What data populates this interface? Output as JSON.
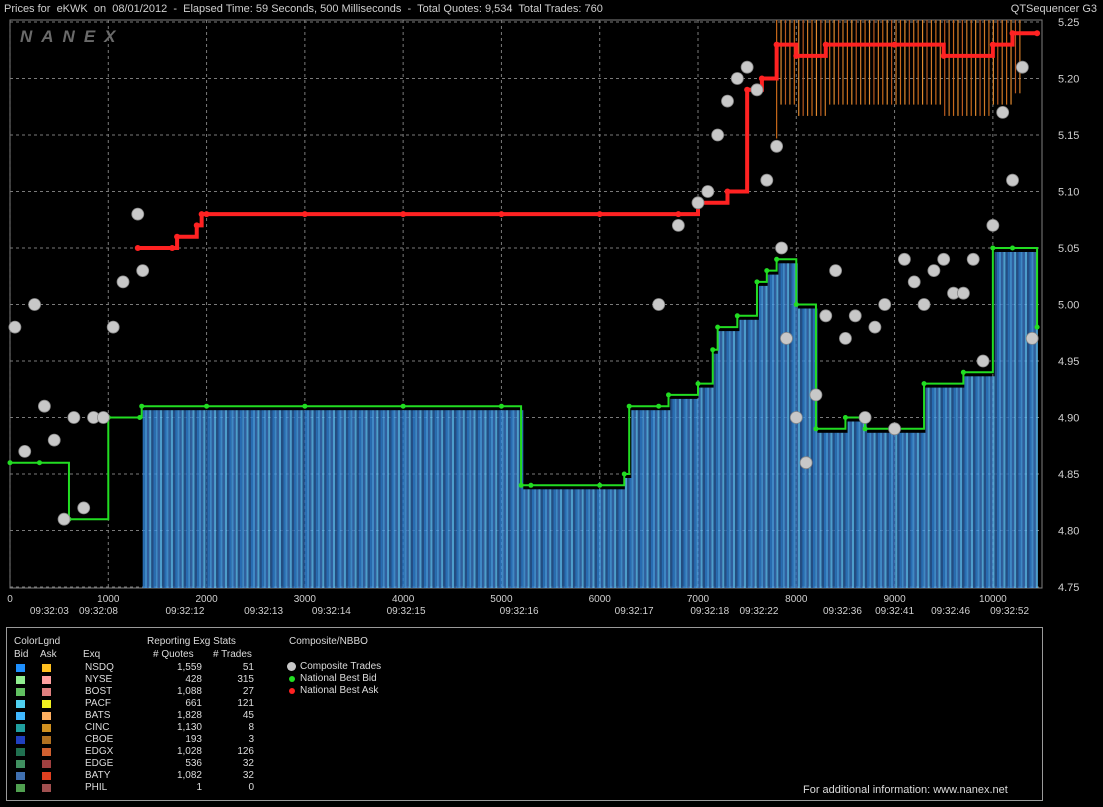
{
  "title": {
    "left": "Prices for  eKWK  on  08/01/2012  -  Elapsed Time: 59 Seconds, 500 Milliseconds  -  Total Quotes: 9,534  Total Trades: 760",
    "right": "QTSequencer G3"
  },
  "watermark": "NANEX",
  "chart_data": {
    "type": "line",
    "x_ticks": [
      0,
      1000,
      2000,
      3000,
      4000,
      5000,
      6000,
      7000,
      8000,
      9000,
      10000
    ],
    "x_range": [
      0,
      10500
    ],
    "time_labels": [
      {
        "x": 400,
        "label": "09:32:03"
      },
      {
        "x": 900,
        "label": "09:32:08"
      },
      {
        "x": 1780,
        "label": "09:32:12"
      },
      {
        "x": 2580,
        "label": "09:32:13"
      },
      {
        "x": 3270,
        "label": "09:32:14"
      },
      {
        "x": 4030,
        "label": "09:32:15"
      },
      {
        "x": 5180,
        "label": "09:32:16"
      },
      {
        "x": 6350,
        "label": "09:32:17"
      },
      {
        "x": 7120,
        "label": "09:32:18"
      },
      {
        "x": 7620,
        "label": "09:32:22"
      },
      {
        "x": 8470,
        "label": "09:32:36"
      },
      {
        "x": 9000,
        "label": "09:32:41"
      },
      {
        "x": 9570,
        "label": "09:32:46"
      },
      {
        "x": 10170,
        "label": "09:32:52"
      }
    ],
    "y_ticks": [
      "5.25",
      "5.20",
      "5.15",
      "5.10",
      "5.05",
      "5.00",
      "4.95",
      "4.90",
      "4.85",
      "4.80",
      "4.75"
    ],
    "y_range": [
      4.75,
      5.25
    ],
    "grid": true,
    "series": [
      {
        "name": "National Best Bid",
        "color": "#22dd22",
        "x": [
          0,
          300,
          600,
          1000,
          1320,
          1340,
          2000,
          3000,
          4000,
          5000,
          5200,
          5300,
          6000,
          6250,
          6300,
          6600,
          6700,
          7000,
          7150,
          7200,
          7400,
          7600,
          7700,
          7800,
          8000,
          8200,
          8500,
          8700,
          9000,
          9300,
          9700,
          10000,
          10200,
          10450
        ],
        "values": [
          4.86,
          4.86,
          4.81,
          4.9,
          4.9,
          4.91,
          4.91,
          4.91,
          4.91,
          4.91,
          4.84,
          4.84,
          4.84,
          4.85,
          4.91,
          4.91,
          4.92,
          4.93,
          4.96,
          4.98,
          4.99,
          5.02,
          5.03,
          5.04,
          5.0,
          4.89,
          4.9,
          4.89,
          4.89,
          4.93,
          4.94,
          5.05,
          5.05,
          4.98
        ]
      },
      {
        "name": "National Best Ask",
        "color": "#ff2222",
        "x": [
          1300,
          1650,
          1700,
          1900,
          1950,
          2000,
          3000,
          4000,
          5000,
          6000,
          6800,
          7000,
          7300,
          7500,
          7650,
          7800,
          8000,
          8300,
          9000,
          9500,
          10000,
          10200,
          10450
        ],
        "values": [
          5.05,
          5.05,
          5.06,
          5.07,
          5.08,
          5.08,
          5.08,
          5.08,
          5.08,
          5.08,
          5.08,
          5.09,
          5.1,
          5.19,
          5.2,
          5.23,
          5.22,
          5.23,
          5.23,
          5.22,
          5.23,
          5.24,
          5.24
        ]
      },
      {
        "name": "Composite Trades",
        "color": "#c8c8c8",
        "x": [
          50,
          150,
          250,
          350,
          450,
          550,
          650,
          750,
          850,
          950,
          1050,
          1150,
          1300,
          1350,
          6600,
          6800,
          7000,
          7100,
          7200,
          7300,
          7400,
          7500,
          7600,
          7700,
          7800,
          7850,
          7900,
          8000,
          8100,
          8200,
          8300,
          8400,
          8500,
          8600,
          8700,
          8800,
          8900,
          9000,
          9100,
          9200,
          9300,
          9400,
          9500,
          9600,
          9700,
          9800,
          9900,
          10000,
          10100,
          10200,
          10300,
          10400
        ],
        "values": [
          4.98,
          4.87,
          5.0,
          4.91,
          4.88,
          4.81,
          4.9,
          4.82,
          4.9,
          4.9,
          4.98,
          5.02,
          5.08,
          5.03,
          5.0,
          5.07,
          5.09,
          5.1,
          5.15,
          5.18,
          5.2,
          5.21,
          5.19,
          5.11,
          5.14,
          5.05,
          4.97,
          4.9,
          4.86,
          4.92,
          4.99,
          5.03,
          4.97,
          4.99,
          4.9,
          4.98,
          5.0,
          4.89,
          5.04,
          5.02,
          5.0,
          5.03,
          5.04,
          5.01,
          5.01,
          5.04,
          4.95,
          5.07,
          5.17,
          5.11,
          5.21,
          4.97
        ]
      }
    ]
  },
  "panel": {
    "headers": {
      "color_legend": "ColorLgnd",
      "bid": "Bid",
      "ask": "Ask",
      "exg_stats": "Reporting Exg Stats",
      "quotes": "# Quotes",
      "trades": "# Trades",
      "exq": "Exq",
      "nbbo": "Composite/NBBO"
    },
    "exchanges": [
      {
        "name": "NSDQ",
        "quotes": "1,559",
        "trades": "51",
        "bid_color": "#1e90ff",
        "ask_color": "#ffc020"
      },
      {
        "name": "NYSE",
        "quotes": "428",
        "trades": "315",
        "bid_color": "#90ee90",
        "ask_color": "#ffa0a0"
      },
      {
        "name": "BOST",
        "quotes": "1,088",
        "trades": "27",
        "bid_color": "#60c060",
        "ask_color": "#e08080"
      },
      {
        "name": "PACF",
        "quotes": "661",
        "trades": "121",
        "bid_color": "#50d0f0",
        "ask_color": "#f0f020"
      },
      {
        "name": "BATS",
        "quotes": "1,828",
        "trades": "45",
        "bid_color": "#40b8ff",
        "ask_color": "#ffb060"
      },
      {
        "name": "CINC",
        "quotes": "1,130",
        "trades": "8",
        "bid_color": "#20a0a0",
        "ask_color": "#d09020"
      },
      {
        "name": "CBOE",
        "quotes": "193",
        "trades": "3",
        "bid_color": "#2040c0",
        "ask_color": "#b07020"
      },
      {
        "name": "EDGX",
        "quotes": "1,028",
        "trades": "126",
        "bid_color": "#207050",
        "ask_color": "#d06030"
      },
      {
        "name": "EDGE",
        "quotes": "536",
        "trades": "32",
        "bid_color": "#409060",
        "ask_color": "#a04040"
      },
      {
        "name": "BATY",
        "quotes": "1,082",
        "trades": "32",
        "bid_color": "#4070b0",
        "ask_color": "#e04020"
      },
      {
        "name": "PHIL",
        "quotes": "1",
        "trades": "0",
        "bid_color": "#50a050",
        "ask_color": "#a05050"
      }
    ],
    "nbbo_legend": [
      {
        "label": "Composite Trades",
        "color": "#c8c8c8"
      },
      {
        "label": "National Best Bid",
        "color": "#22dd22"
      },
      {
        "label": "National Best Ask",
        "color": "#ff2222"
      }
    ],
    "footer": "For additional information: www.nanex.net"
  }
}
